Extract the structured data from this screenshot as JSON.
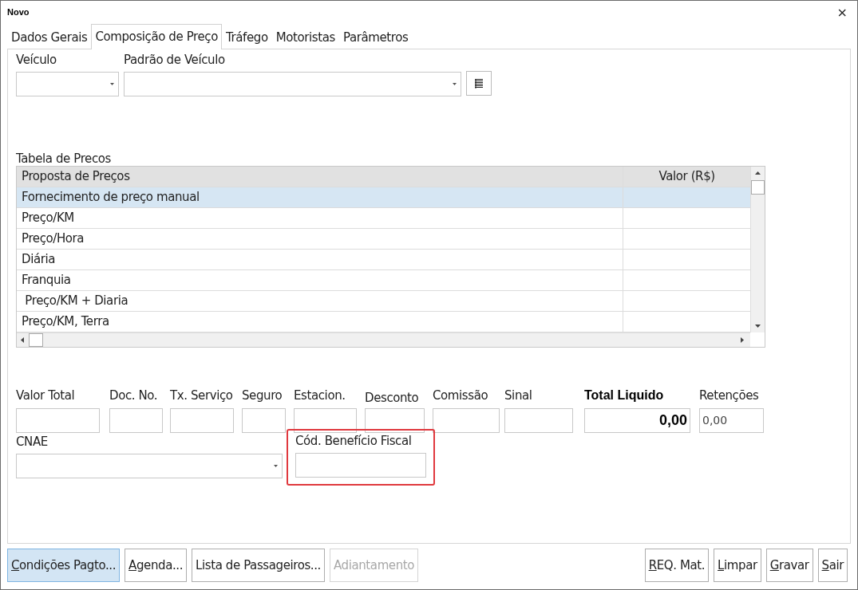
{
  "window": {
    "title": "Novo",
    "close": "×"
  },
  "tabs": [
    {
      "label": "Dados Gerais",
      "selected": false
    },
    {
      "label": "Composição de Preço",
      "selected": true
    },
    {
      "label": "Tráfego",
      "selected": false
    },
    {
      "label": "Motoristas",
      "selected": false
    },
    {
      "label": "Parâmetros",
      "selected": false
    }
  ],
  "vehicle": {
    "label": "Veículo"
  },
  "vehicle_pattern": {
    "label": "Padrão de Veículo"
  },
  "price_table": {
    "label": "Tabela de Precos",
    "columns": [
      "Proposta de Preços",
      "Valor (R$)"
    ],
    "rows": [
      {
        "name": "Fornecimento de preço manual",
        "value": "",
        "selected": true
      },
      {
        "name": "Preço/KM",
        "value": "",
        "selected": false
      },
      {
        "name": "Preço/Hora",
        "value": "",
        "selected": false
      },
      {
        "name": "Diária",
        "value": "",
        "selected": false
      },
      {
        "name": "Franquia",
        "value": "",
        "selected": false
      },
      {
        "name": " Preço/KM + Diaria",
        "value": "",
        "selected": false
      },
      {
        "name": "Preço/KM, Terra",
        "value": "",
        "selected": false
      }
    ]
  },
  "fields": [
    {
      "label": "Valor Total",
      "kind": "text"
    },
    {
      "label": "Doc. No.",
      "kind": "text"
    },
    {
      "label": "Tx. Serviço",
      "kind": "text"
    },
    {
      "label": "Seguro",
      "kind": "text"
    },
    {
      "label": "Estacion.",
      "kind": "text"
    },
    {
      "label": "Desconto",
      "kind": "text"
    },
    {
      "label": "Comissão",
      "kind": "text"
    },
    {
      "label": "Sinal",
      "kind": "text"
    },
    {
      "label": "Total Liquido",
      "kind": "total",
      "value": "0,00"
    },
    {
      "label": "Retenções",
      "kind": "text",
      "value": "0,00"
    }
  ],
  "cnae": {
    "label": "CNAE"
  },
  "fiscal_benefit": {
    "label": "Cód. Benefício Fiscal",
    "highlighted": true
  },
  "buttons_left": [
    {
      "label": "Condições Pagto...",
      "mnemonic": true,
      "focused": true,
      "disabled": false
    },
    {
      "label": "Agenda...",
      "mnemonic": true,
      "focused": false,
      "disabled": false
    },
    {
      "label": "Lista de Passageiros...",
      "mnemonic": false,
      "focused": false,
      "disabled": false
    },
    {
      "label": "Adiantamento",
      "mnemonic": false,
      "focused": false,
      "disabled": true
    }
  ],
  "buttons_right": [
    {
      "label": "REQ. Mat.",
      "mnemonic": true,
      "focused": false,
      "disabled": false
    },
    {
      "label": "Limpar",
      "mnemonic": true,
      "focused": false,
      "disabled": false
    },
    {
      "label": "Gravar",
      "mnemonic": true,
      "focused": false,
      "disabled": false
    },
    {
      "label": "Sair",
      "mnemonic": true,
      "focused": false,
      "disabled": false
    }
  ]
}
